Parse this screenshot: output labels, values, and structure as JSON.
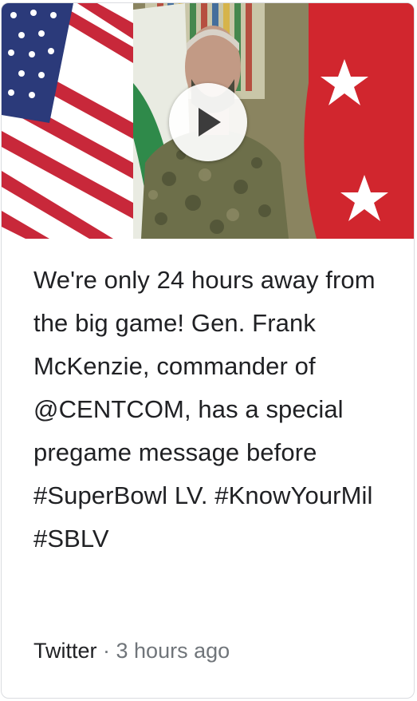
{
  "video": {
    "play_icon": "play-icon"
  },
  "post": {
    "text": "We're only 24 hours away from the big game! Gen. Frank McKenzie, commander of @CENTCOM, has a special pregame message before #SuperBowl LV. #KnowYourMil #SBLV"
  },
  "footer": {
    "source": "Twitter",
    "separator": " · ",
    "time": "3 hours ago"
  }
}
